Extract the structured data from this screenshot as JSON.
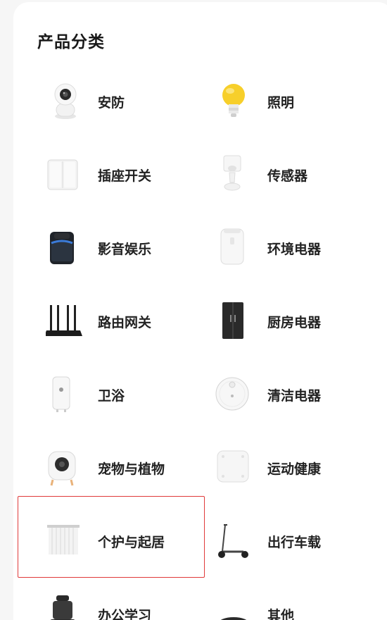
{
  "section": {
    "title": "产品分类"
  },
  "categories": [
    {
      "label": "安防",
      "icon": "camera-icon"
    },
    {
      "label": "照明",
      "icon": "bulb-icon"
    },
    {
      "label": "插座开关",
      "icon": "switch-icon"
    },
    {
      "label": "传感器",
      "icon": "sensor-icon"
    },
    {
      "label": "影音娱乐",
      "icon": "speaker-icon"
    },
    {
      "label": "环境电器",
      "icon": "humidifier-icon"
    },
    {
      "label": "路由网关",
      "icon": "router-icon"
    },
    {
      "label": "厨房电器",
      "icon": "fridge-icon"
    },
    {
      "label": "卫浴",
      "icon": "water-heater-icon"
    },
    {
      "label": "清洁电器",
      "icon": "robot-vacuum-icon"
    },
    {
      "label": "宠物与植物",
      "icon": "pet-feeder-icon"
    },
    {
      "label": "运动健康",
      "icon": "scale-icon"
    },
    {
      "label": "个护与起居",
      "icon": "curtain-icon"
    },
    {
      "label": "出行车载",
      "icon": "scooter-icon"
    },
    {
      "label": "办公学习",
      "icon": "chair-icon"
    },
    {
      "label": "其他",
      "icon": "round-device-icon"
    }
  ]
}
